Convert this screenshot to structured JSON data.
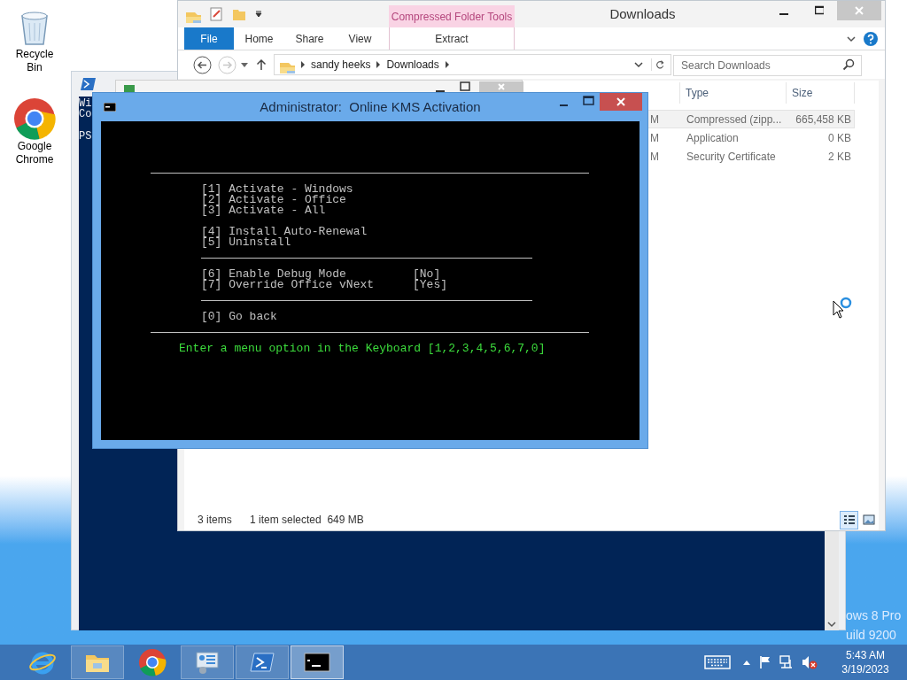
{
  "desktop": {
    "icons": [
      {
        "kind": "trash",
        "label": "Recycle Bin"
      },
      {
        "kind": "browser",
        "label": "Google Chrome"
      }
    ],
    "edition_lines": [
      "ows 8 Pro",
      "uild 9200"
    ]
  },
  "powershell_window": {
    "lines": [
      "Wi",
      "Co",
      "PS"
    ]
  },
  "explorer": {
    "title": "Downloads",
    "contextual_tab": "Compressed Folder Tools",
    "tabs": [
      {
        "kind": "file",
        "label": "File"
      },
      {
        "kind": "plain",
        "label": "Home"
      },
      {
        "kind": "plain",
        "label": "Share"
      },
      {
        "kind": "plain",
        "label": "View"
      },
      {
        "kind": "contextual",
        "label": "Extract"
      }
    ],
    "breadcrumb": [
      "sandy heeks",
      "Downloads"
    ],
    "search": {
      "placeholder": "Search Downloads"
    },
    "columns": [
      "Type",
      "Size"
    ],
    "rows": [
      {
        "date_modified": "M",
        "type": "Compressed (zipp...",
        "size": "665,458 KB",
        "selected": true
      },
      {
        "date_modified": "M",
        "type": "Application",
        "size": "0 KB",
        "selected": false
      },
      {
        "date_modified": "M",
        "type": "Security Certificate",
        "size": "2 KB",
        "selected": false
      }
    ],
    "status_bar": {
      "count": "3 items",
      "selection": "1 item selected  649 MB"
    },
    "view_buttons": [
      {
        "kind": "details",
        "selected": true
      },
      {
        "kind": "thumbnails",
        "selected": false
      }
    ]
  },
  "console_window": {
    "title": "Administrator:  Online KMS Activation",
    "lines": [
      {
        "kind": "rule_wide"
      },
      {
        "kind": "item",
        "text": "[1] Activate - Windows"
      },
      {
        "kind": "item",
        "text": "[2] Activate - Office"
      },
      {
        "kind": "item",
        "text": "[3] Activate - All"
      },
      {
        "kind": "blank"
      },
      {
        "kind": "item",
        "text": "[4] Install Auto-Renewal"
      },
      {
        "kind": "item",
        "text": "[5] Uninstall"
      },
      {
        "kind": "rule_narrow"
      },
      {
        "kind": "item",
        "text": "[6] Enable Debug Mode",
        "value": "[No]"
      },
      {
        "kind": "item",
        "text": "[7] Override Office vNext",
        "value": "[Yes]"
      },
      {
        "kind": "rule_narrow"
      },
      {
        "kind": "item",
        "text": "[0] Go back"
      },
      {
        "kind": "rule_wide"
      },
      {
        "kind": "prompt",
        "text": "Enter a menu option in the Keyboard [1,2,3,4,5,6,7,0]"
      }
    ]
  },
  "taskbar": {
    "apps": [
      {
        "kind": "browser_e",
        "running": false,
        "selected": false
      },
      {
        "kind": "folder",
        "running": true,
        "selected": false
      },
      {
        "kind": "browser",
        "running": false,
        "selected": false
      },
      {
        "kind": "dashboard",
        "running": true,
        "selected": false
      },
      {
        "kind": "terminal",
        "running": true,
        "selected": false
      },
      {
        "kind": "console",
        "running": true,
        "selected": true
      }
    ],
    "clock": {
      "time": "5:43 AM",
      "date": "3/19/2023"
    }
  }
}
